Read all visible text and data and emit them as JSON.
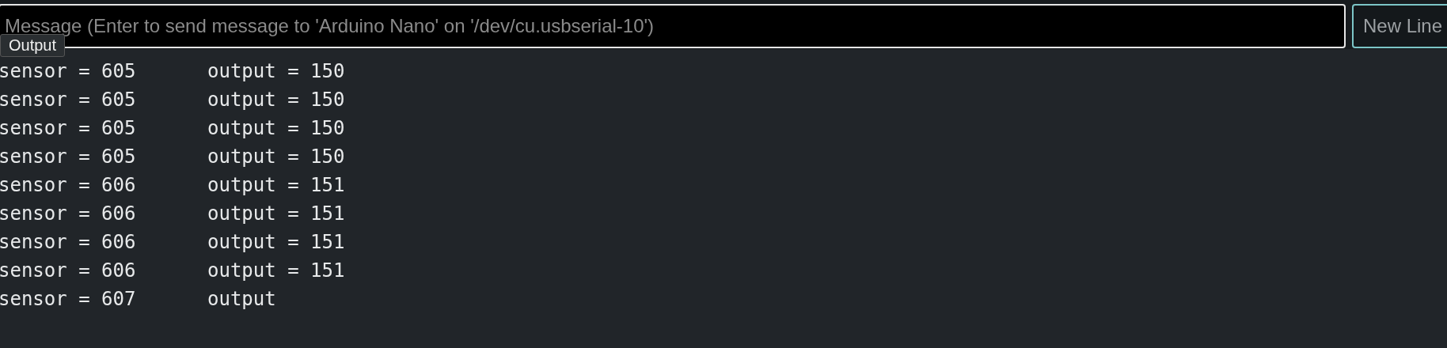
{
  "message_field": {
    "placeholder": "Message (Enter to send message to 'Arduino Nano' on '/dev/cu.usbserial-10')"
  },
  "line_ending": {
    "value": "New Line"
  },
  "tooltip": {
    "text": "Output"
  },
  "output_lines": [
    {
      "sensor": "sensor = 605",
      "output": "output = 150"
    },
    {
      "sensor": "sensor = 605",
      "output": "output = 150"
    },
    {
      "sensor": "sensor = 605",
      "output": "output = 150"
    },
    {
      "sensor": "sensor = 605",
      "output": "output = 150"
    },
    {
      "sensor": "sensor = 606",
      "output": "output = 151"
    },
    {
      "sensor": "sensor = 606",
      "output": "output = 151"
    },
    {
      "sensor": "sensor = 606",
      "output": "output = 151"
    },
    {
      "sensor": "sensor = 606",
      "output": "output = 151"
    },
    {
      "sensor": "sensor = 607",
      "output": "output"
    }
  ]
}
